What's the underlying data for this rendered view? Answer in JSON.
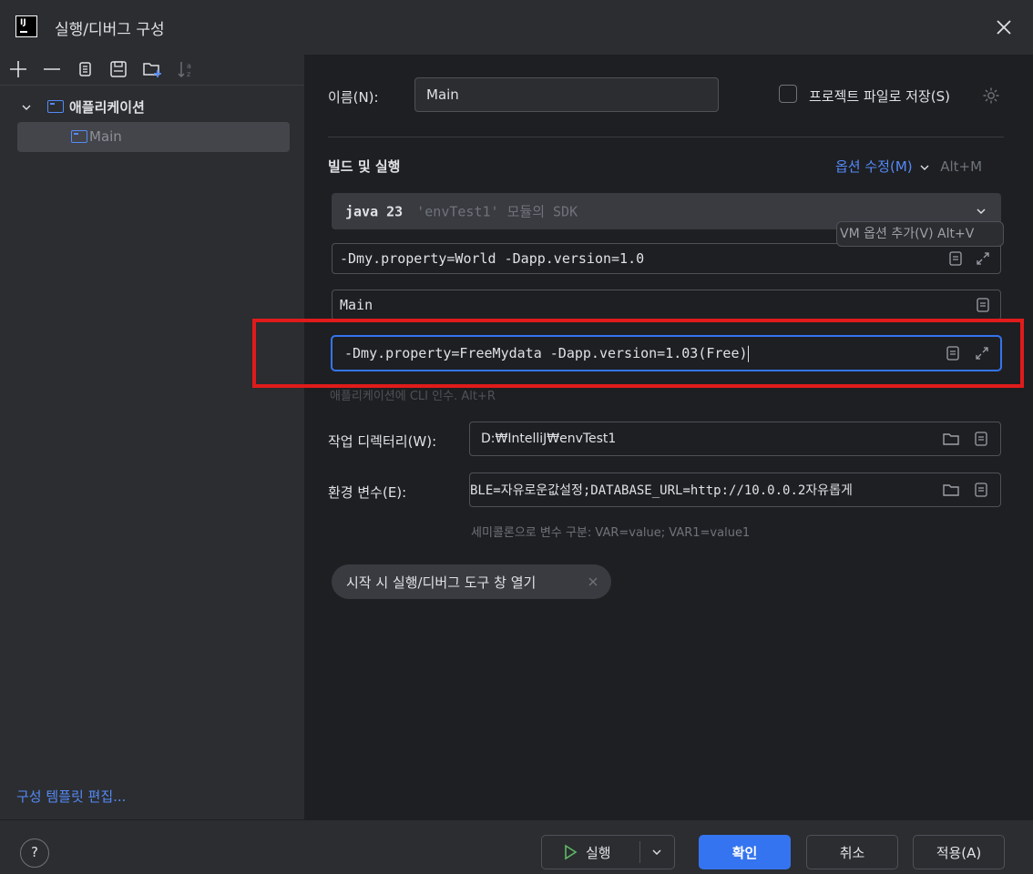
{
  "window": {
    "title": "실행/디버그 구성"
  },
  "toolbar": {
    "icons": [
      "add-icon",
      "remove-icon",
      "copy-icon",
      "save-icon",
      "new-folder-icon",
      "sort-icon"
    ]
  },
  "tree": {
    "group_label": "애플리케이션",
    "selected_item": "Main"
  },
  "template_link": "구성 템플릿 편집...",
  "form": {
    "name_label": "이름(N):",
    "name_label_mnemonic": "N",
    "name_value": "Main",
    "store_as_file_label": "프로젝트 파일로 저장(S)",
    "store_as_file_checked": false,
    "section_title": "빌드 및 실행",
    "modify_options_label": "옵션 수정(M)",
    "modify_options_shortcut": "Alt+M",
    "sdk_value_bold": "java 23",
    "sdk_value_muted": "'envTest1' 모듈의 SDK",
    "vm_options_value": "-Dmy.property=World -Dapp.version=1.0",
    "vm_tooltip": "VM 옵션 추가(V) Alt+V",
    "main_class_value": "Main",
    "program_args_value": "-Dmy.property=FreeMydata -Dapp.version=1.03(Free)",
    "program_args_hint": "애플리케이션에 CLI 인수. Alt+R",
    "workdir_label": "작업 디렉터리(W):",
    "workdir_value": "D:₩IntelliJ₩envTest1",
    "env_label": "환경 변수(E):",
    "env_value": "BLE=자유로운값설정;DATABASE_URL=http://10.0.0.2자유롭게",
    "env_hint": "세미콜론으로 변수 구분: VAR=value; VAR1=value1",
    "chip_label": "시작 시 실행/디버그 도구 창 열기"
  },
  "buttons": {
    "run": "실행",
    "ok": "확인",
    "cancel": "취소",
    "apply": "적용(A)",
    "help": "?"
  },
  "colors": {
    "accent": "#548af7",
    "primary_button": "#3574f0",
    "highlight_box": "#e01b1b",
    "run_icon": "#5fb865"
  }
}
